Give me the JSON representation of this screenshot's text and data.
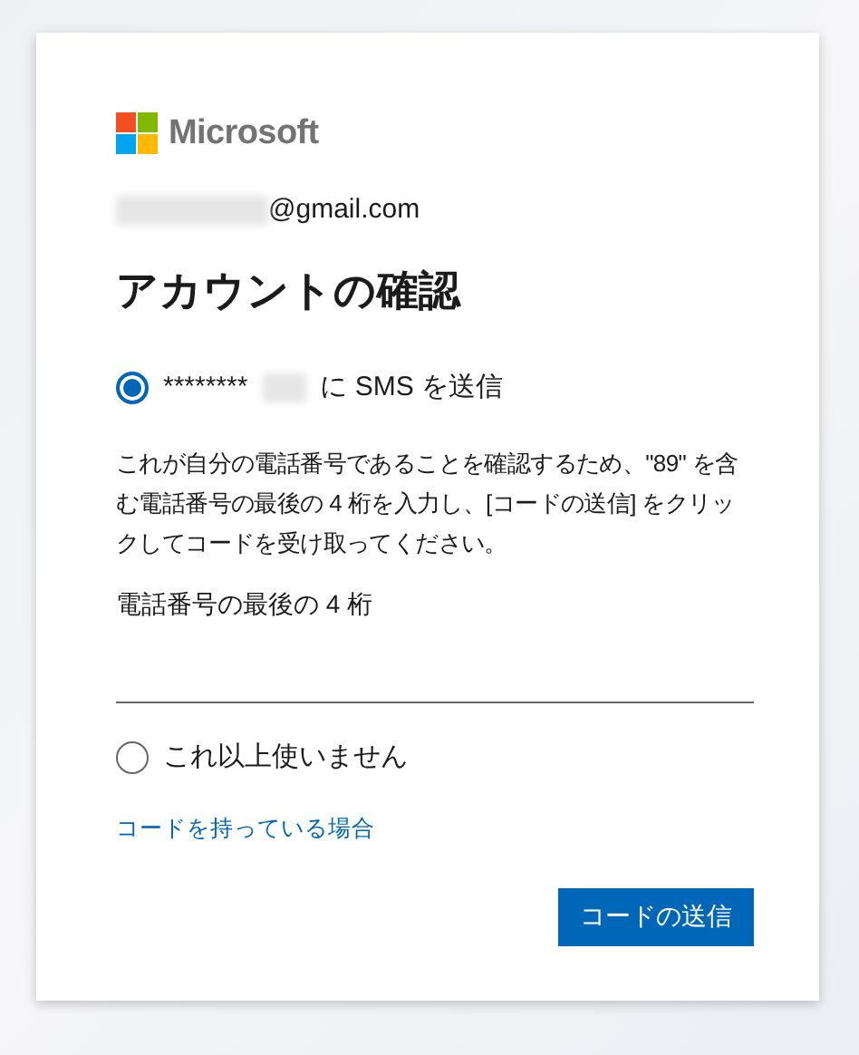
{
  "logo": {
    "text": "Microsoft"
  },
  "account": {
    "email_suffix": "@gmail.com",
    "redacted": true
  },
  "title": "アカウントの確認",
  "options": [
    {
      "kind": "sms",
      "masked": "********",
      "redacted": true,
      "label": "に SMS を送信",
      "selected": true
    },
    {
      "kind": "plain",
      "label": "これ以上使いません",
      "selected": false
    }
  ],
  "description": "これが自分の電話番号であることを確認するため、\"89\" を含む電話番号の最後の 4 桁を入力し、[コードの送信] をクリックしてコードを受け取ってください。",
  "field": {
    "label": "電話番号の最後の 4 桁"
  },
  "link": "コードを持っている場合",
  "button": "コードの送信"
}
